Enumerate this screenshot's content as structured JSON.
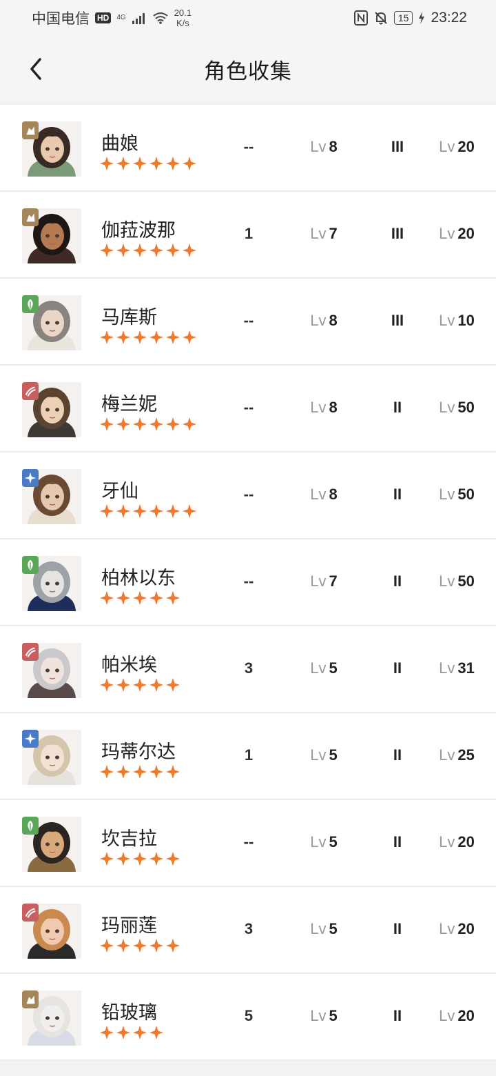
{
  "status_bar": {
    "carrier": "中国电信",
    "hd": "HD",
    "network": "4G",
    "speed_value": "20.1",
    "speed_unit": "K/s",
    "battery": "15",
    "time": "23:22"
  },
  "header": {
    "title": "角色收集"
  },
  "lv_label": "Lv",
  "colors": {
    "star": "#f07a2c",
    "rock": "#a5865a",
    "plant": "#5aa75a",
    "fire": "#c95e5e",
    "star_element": "#4a7bc8"
  },
  "characters": [
    {
      "name": "曲娘",
      "element": "rock-icon",
      "stars": 6,
      "col_a": "--",
      "level": "8",
      "insight": "III",
      "rank_level": "20"
    },
    {
      "name": "伽菈波那",
      "element": "rock-icon",
      "stars": 6,
      "col_a": "1",
      "level": "7",
      "insight": "III",
      "rank_level": "20"
    },
    {
      "name": "马库斯",
      "element": "plant-icon",
      "stars": 6,
      "col_a": "--",
      "level": "8",
      "insight": "III",
      "rank_level": "10"
    },
    {
      "name": "梅兰妮",
      "element": "beast-icon",
      "stars": 6,
      "col_a": "--",
      "level": "8",
      "insight": "II",
      "rank_level": "50"
    },
    {
      "name": "牙仙",
      "element": "star-icon",
      "stars": 6,
      "col_a": "--",
      "level": "8",
      "insight": "II",
      "rank_level": "50"
    },
    {
      "name": "柏林以东",
      "element": "plant-icon",
      "stars": 5,
      "col_a": "--",
      "level": "7",
      "insight": "II",
      "rank_level": "50"
    },
    {
      "name": "帕米埃",
      "element": "beast-icon",
      "stars": 5,
      "col_a": "3",
      "level": "5",
      "insight": "II",
      "rank_level": "31"
    },
    {
      "name": "玛蒂尔达",
      "element": "star-icon",
      "stars": 5,
      "col_a": "1",
      "level": "5",
      "insight": "II",
      "rank_level": "25"
    },
    {
      "name": "坎吉拉",
      "element": "plant-icon",
      "stars": 5,
      "col_a": "--",
      "level": "5",
      "insight": "II",
      "rank_level": "20"
    },
    {
      "name": "玛丽莲",
      "element": "beast-icon",
      "stars": 5,
      "col_a": "3",
      "level": "5",
      "insight": "II",
      "rank_level": "20"
    },
    {
      "name": "铅玻璃",
      "element": "rock-icon",
      "stars": 4,
      "col_a": "5",
      "level": "5",
      "insight": "II",
      "rank_level": "20"
    }
  ]
}
